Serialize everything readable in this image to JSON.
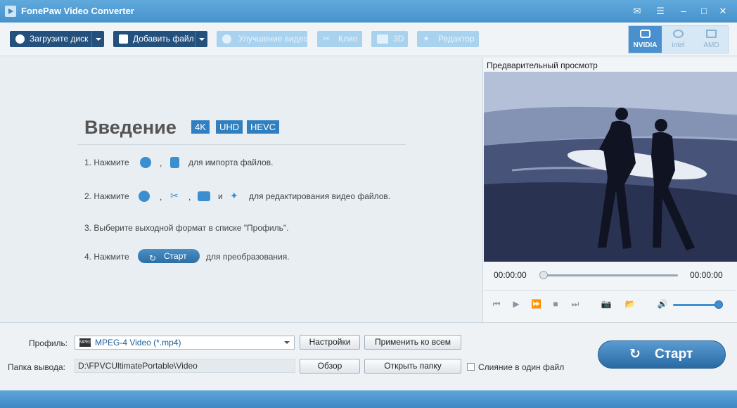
{
  "app": {
    "title": "FonePaw Video Converter"
  },
  "toolbar": {
    "load_disc": "Загрузите диск",
    "add_file": "Добавить файл",
    "enhance": "Улучшение видео",
    "clip": "Клип",
    "three_d": "3D",
    "editor": "Редактор"
  },
  "accel": {
    "nvidia": "NVIDIA",
    "intel": "intel",
    "amd": "AMD"
  },
  "intro": {
    "title": "Введение",
    "badges": [
      "4K",
      "UHD",
      "HEVC"
    ],
    "step1_a": "1. Нажмите",
    "step1_b": "для импорта файлов.",
    "step2_a": "2. Нажмите",
    "step2_and": "и",
    "step2_b": "для редактирования видео файлов.",
    "step3": "3. Выберите выходной формат в списке \"Профиль\".",
    "step4_a": "4. Нажмите",
    "step4_btn": "Старт",
    "step4_b": "для преобразования.",
    "comma": ","
  },
  "preview": {
    "title": "Предварительный просмотр",
    "time_current": "00:00:00",
    "time_total": "00:00:00",
    "progress": 0,
    "volume": 0.9
  },
  "bottom": {
    "profile_label": "Профиль:",
    "profile_value": "MPEG-4 Video (*.mp4)",
    "profile_icon_text": "MPEG",
    "settings": "Настройки",
    "apply_all": "Применить ко всем",
    "output_label": "Папка вывода:",
    "output_path": "D:\\FPVCUltimatePortable\\Video",
    "browse": "Обзор",
    "open_folder": "Открыть папку",
    "merge": "Слияние в один файл",
    "start": "Старт"
  },
  "colors": {
    "accent": "#2f7fc1",
    "dark_button": "#24507d",
    "title_bar": "#4792cc"
  }
}
